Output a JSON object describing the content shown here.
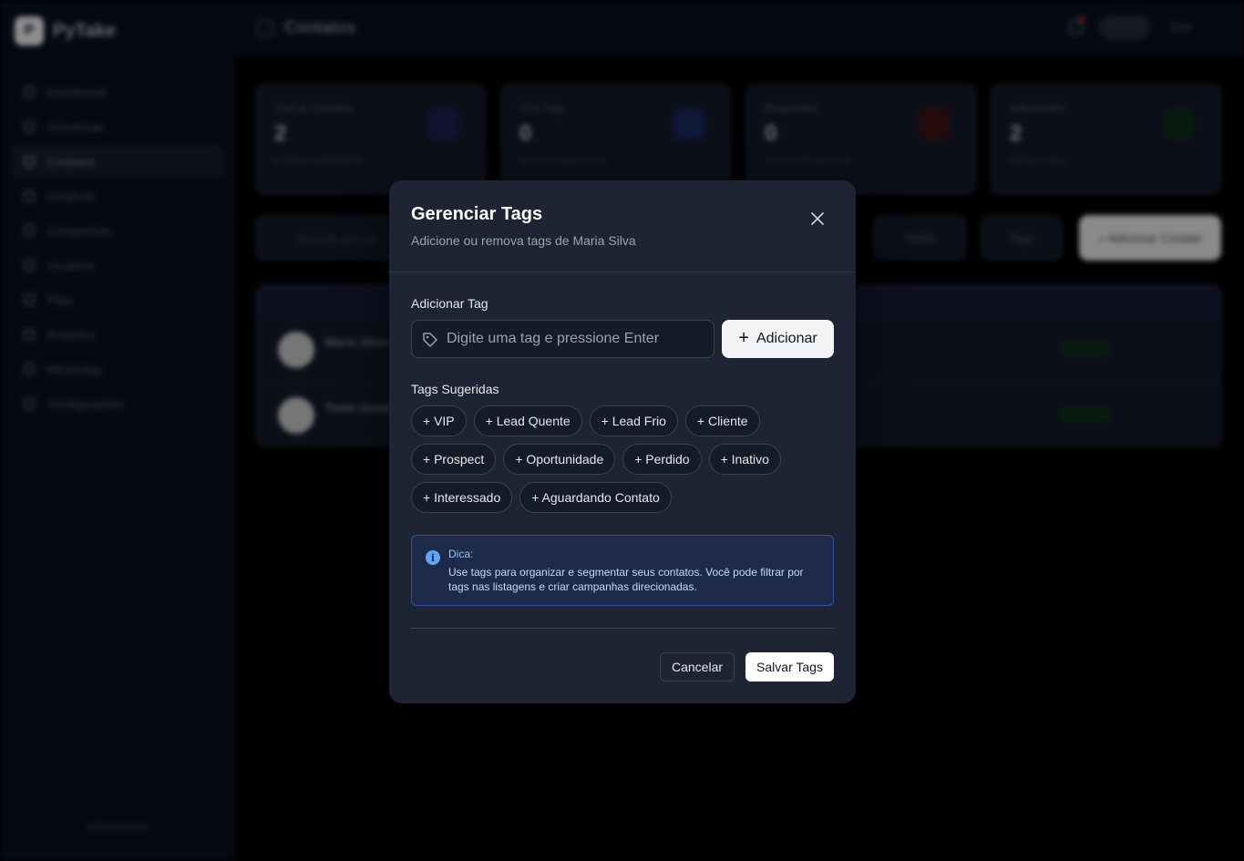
{
  "app": {
    "name": "PyTake",
    "page_title": "Contatos",
    "user_label": "Sair",
    "footer": "Administrador",
    "nav_items": [
      "Dashboard",
      "Conversas",
      "Contatos",
      "Chatbots",
      "Campanhas",
      "Usuários",
      "Filas",
      "Analytics",
      "WhatsApp",
      "Configurações"
    ],
    "stats": [
      {
        "label": "Total de Contatos",
        "value": "2",
        "sub": "contatos cadastrados"
      },
      {
        "label": "Com Tags",
        "value": "0",
        "sub": "contatos organizados"
      },
      {
        "label": "Bloqueados",
        "value": "0",
        "sub": "contatos bloqueados"
      },
      {
        "label": "Adicionados",
        "value": "2",
        "sub": "últimos 7 dias"
      }
    ],
    "search_placeholder": "Buscar por no",
    "filter_label": "Todos",
    "tags_label": "Tags",
    "add_contact_label": "+ Adicionar Contato",
    "rows": [
      {
        "initial": "M",
        "name": "Maria Silva",
        "status": "Ativo"
      },
      {
        "initial": "T",
        "name": "Teste Usuário",
        "status": "Ativo"
      }
    ]
  },
  "modal": {
    "title": "Gerenciar Tags",
    "subtitle": "Adicione ou remova tags de Maria Silva",
    "add_section_label": "Adicionar Tag",
    "input_placeholder": "Digite uma tag e pressione Enter",
    "add_button": "Adicionar",
    "suggested_label": "Tags Sugeridas",
    "suggested_tags": [
      [
        "+ VIP",
        "+ Lead Quente",
        "+ Lead Frio",
        "+ Cliente"
      ],
      [
        "+ Prospect",
        "+ Oportunidade",
        "+ Perdido",
        "+ Inativo"
      ],
      [
        "+ Interessado",
        "+ Aguardando Contato"
      ]
    ],
    "tip_title": "Dica:",
    "tip_text": "Use tags para organizar e segmentar seus contatos. Você pode filtrar por tags nas listagens e criar campanhas direcionadas.",
    "cancel_button": "Cancelar",
    "save_button": "Salvar Tags"
  },
  "icons": {
    "close": "close-icon",
    "tag": "tag-icon",
    "plus": "plus-icon",
    "info": "info-icon"
  },
  "colors": {
    "modal_bg": "#1e2433",
    "tip_border": "#2f4fb0",
    "tip_icon": "#60a5fa",
    "primary_button": "#f3f4f6"
  }
}
